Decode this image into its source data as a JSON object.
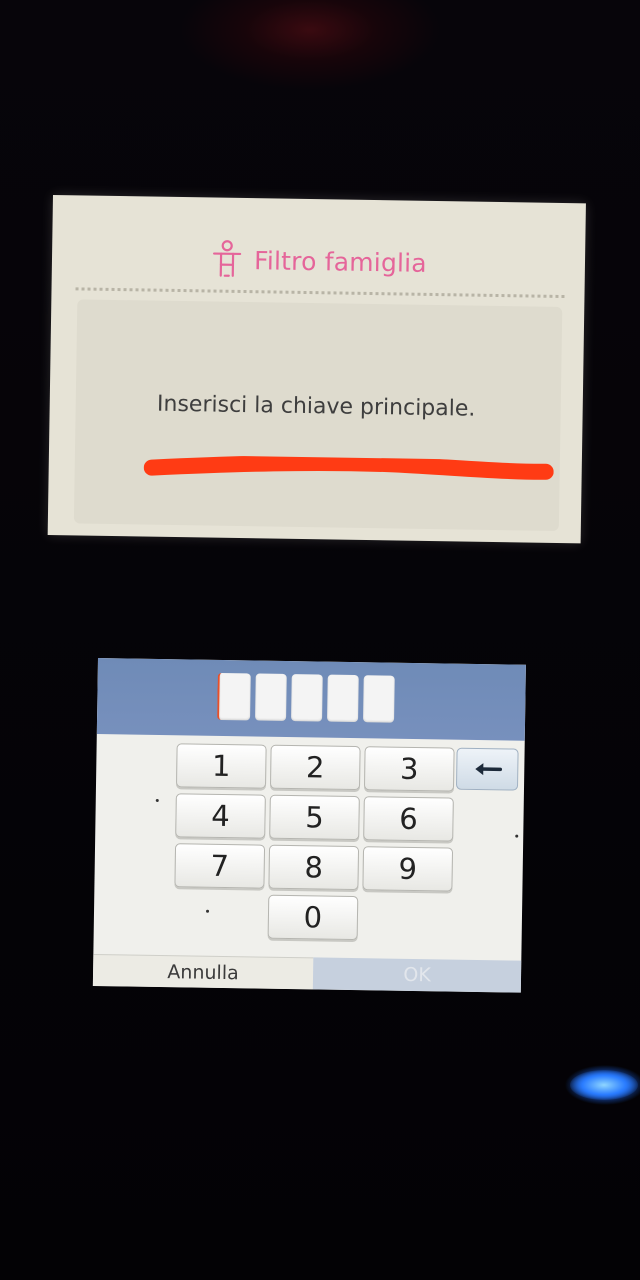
{
  "top_screen": {
    "title": "Filtro famiglia",
    "title_icon": "family-icon",
    "prompt": "Inserisci la chiave principale.",
    "title_color": "#e5659a"
  },
  "keypad": {
    "pin_length": 5,
    "keys": [
      "1",
      "2",
      "3",
      "4",
      "5",
      "6",
      "7",
      "8",
      "9",
      "0"
    ],
    "backspace_icon": "backspace-arrow-icon",
    "cancel_label": "Annulla",
    "ok_label": "OK",
    "entry_bar_color": "#7790bd"
  },
  "colors": {
    "redaction": "#ff3b14"
  }
}
